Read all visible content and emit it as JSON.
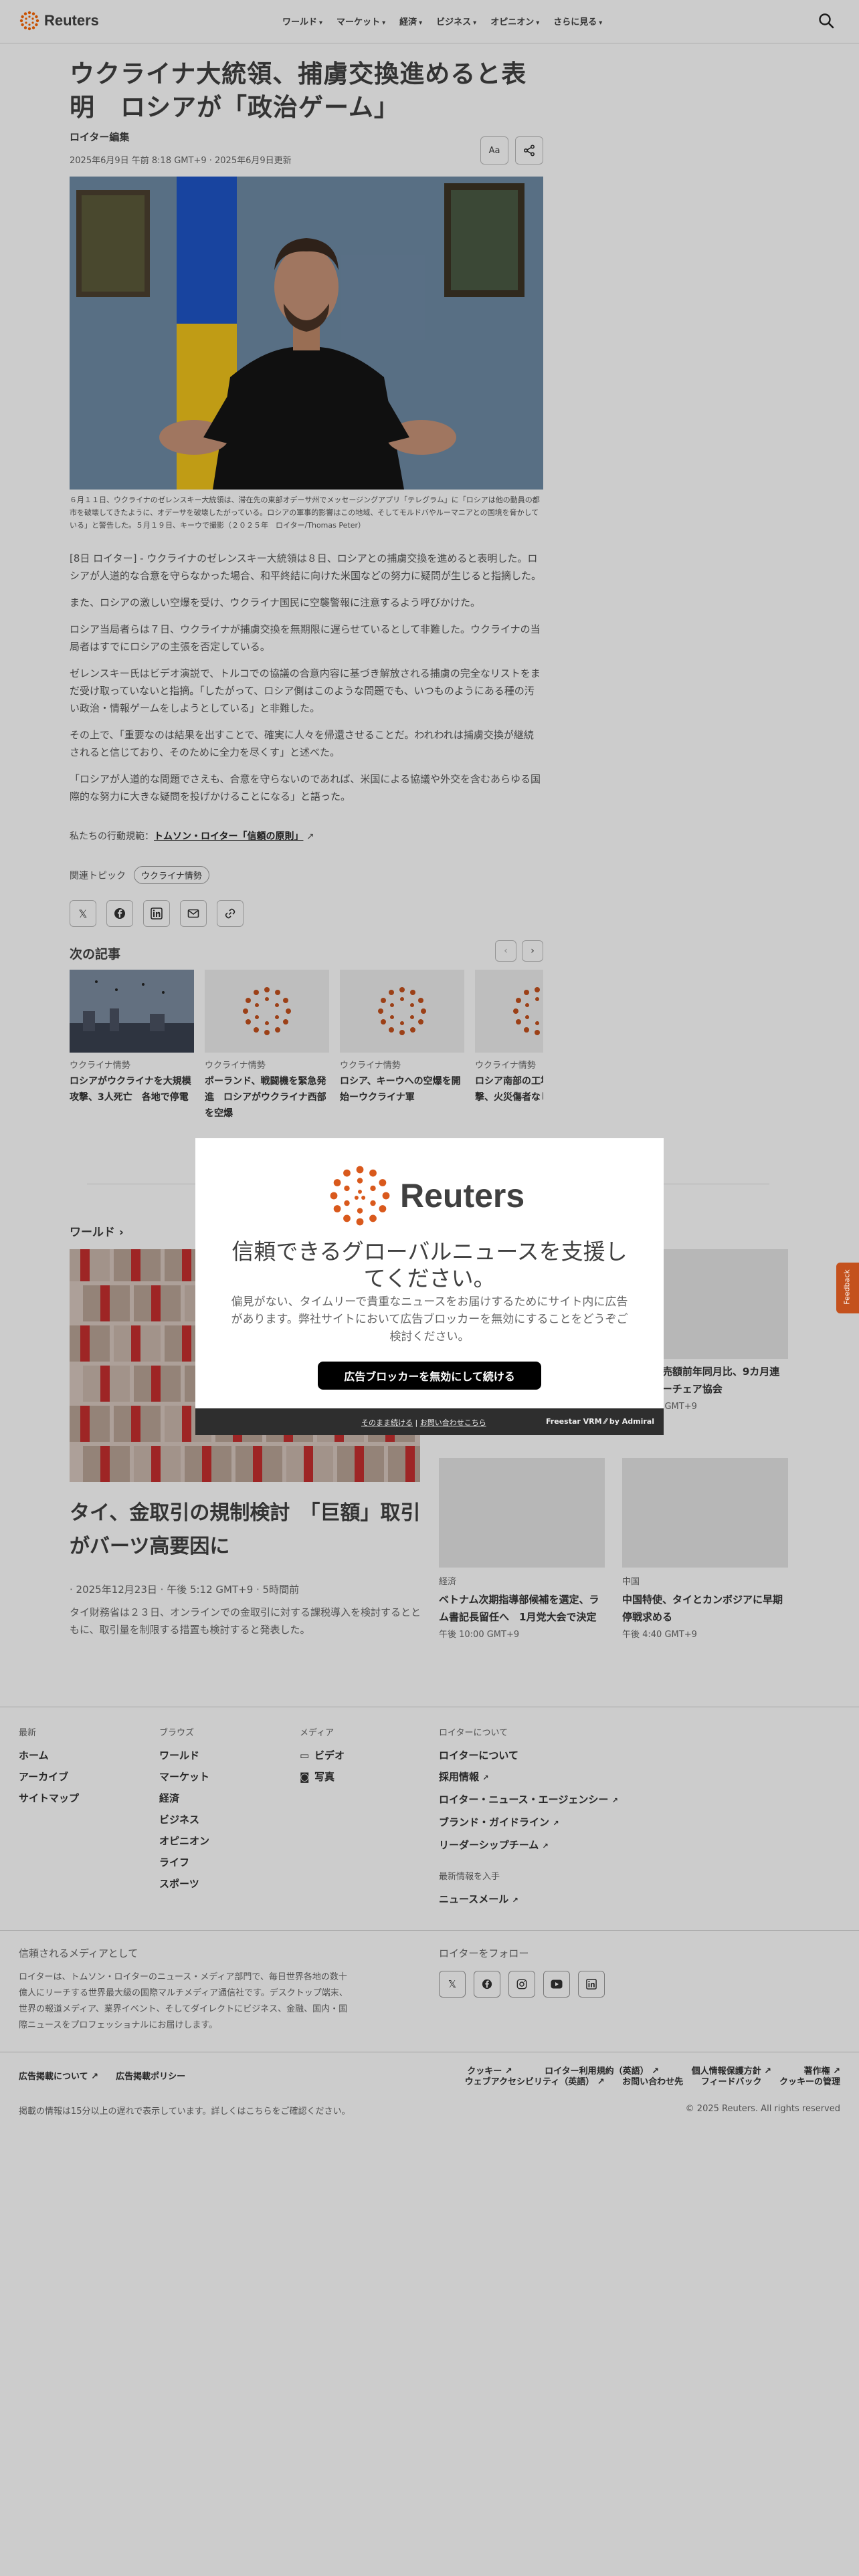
{
  "header": {
    "logo_text": "Reuters",
    "nav": [
      "ワールド",
      "マーケット",
      "経済",
      "ビジネス",
      "オピニオン",
      "さらに見る"
    ]
  },
  "article": {
    "title": "ウクライナ大統領、捕虜交換進めると表明　ロシアが「政治ゲーム」",
    "byline": "ロイター編集",
    "dateline": "2025年6月9日 午前 8:18 GMT+9 · 2025年6月9日更新",
    "font_tool": "Aa",
    "caption": "６月１１日、ウクライナのゼレンスキー大統領は、滞在先の東部オデーサ州でメッセージングアプリ「テレグラム」に「ロシアは他の動員の都市を破壊してきたように、オデーサを破壊したがっている。ロシアの軍事的影響はこの地域、そしてモルドバやルーマニアとの国境を脅かしている」と警告した。５月１９日、キーウで撮影（２０２５年　ロイター/Thomas Peter）",
    "paragraphs": [
      "[8日 ロイター] - ウクライナのゼレンスキー大統領は８日、ロシアとの捕虜交換を進めると表明した。ロシアが人道的な合意を守らなかった場合、和平終結に向けた米国などの努力に疑問が生じると指摘した。",
      "また、ロシアの激しい空爆を受け、ウクライナ国民に空襲警報に注意するよう呼びかけた。",
      "ロシア当局者らは７日、ウクライナが捕虜交換を無期限に遅らせているとして非難した。ウクライナの当局者はすでにロシアの主張を否定している。",
      "ゼレンスキー氏はビデオ演説で、トルコでの協議の合意内容に基づき解放される捕虜の完全なリストをまだ受け取っていないと指摘。「したがって、ロシア側はこのような問題でも、いつものようにある種の汚い政治・情報ゲームをしようとしている」と非難した。",
      "その上で、「重要なのは結果を出すことで、確実に人々を帰還させることだ。われわれは捕虜交換が継続されると信じており、そのために全力を尽くす」と述べた。",
      "「ロシアが人道的な問題でさえも、合意を守らないのであれば、米国による協議や外交を含むあらゆる国際的な努力に大きな疑問を投げかけることになる」と語った。"
    ],
    "principles_prefix": "私たちの行動規範：",
    "principles_link": "トムソン・ロイター「信頼の原則」",
    "topic_label": "関連トピック",
    "topic_chip": "ウクライナ情勢"
  },
  "next": {
    "heading": "次の記事",
    "cards": [
      {
        "kicker": "ウクライナ情勢",
        "title": "ロシアがウクライナを大規模攻撃、3人死亡　各地で停電"
      },
      {
        "kicker": "ウクライナ情勢",
        "title": "ポーランド、戦闘機を緊急発進　ロシアがウクライナ西部を空爆"
      },
      {
        "kicker": "ウクライナ情勢",
        "title": "ロシア、キーウへの空爆を開始ーウクライナ軍"
      },
      {
        "kicker": "ウクライナ情勢",
        "title": "ロシア南部の工場無人機攻撃、火災傷者なし＝当局"
      }
    ]
  },
  "world": {
    "heading": "ワールド",
    "lead_title": "タイ、金取引の規制検討　「巨額」取引がバーツ高要因に",
    "lead_date": "· 2025年12月23日 · 午後 5:12 GMT+9 · 5時間前",
    "lead_desc": "タイ財務省は２３日、オンラインでの金取引に対する課税導入を検討するとともに、取引量を制限する措置も検討すると発表した。",
    "items": [
      {
        "kicker": "",
        "title": "ーバー販売額前年同月比、9カ月連続プラスーチェア協会",
        "time": "午後 4:00 GMT+9"
      },
      {
        "kicker": "経済",
        "title": "ベトナム次期指導部候補を選定、ラム書記長留任へ　1月党大会で決定",
        "time": "午後 10:00 GMT+9"
      },
      {
        "kicker": "中国",
        "title": "中国特使、タイとカンボジアに早期停戦求める",
        "time": "午後 4:40 GMT+9"
      }
    ]
  },
  "footer": {
    "col1": {
      "head": "最新",
      "items": [
        "ホーム",
        "アーカイブ",
        "サイトマップ"
      ]
    },
    "col2": {
      "head": "ブラウズ",
      "items": [
        "ワールド",
        "マーケット",
        "経済",
        "ビジネス",
        "オピニオン",
        "ライフ",
        "スポーツ"
      ]
    },
    "col3": {
      "head": "メディア",
      "items": [
        "ビデオ",
        "写真"
      ]
    },
    "col4": {
      "head": "ロイターについて",
      "items": [
        "ロイターについて",
        "採用情報",
        "ロイター・ニュース・エージェンシー",
        "ブランド・ガイドライン",
        "リーダーシップチーム"
      ],
      "sub_head": "最新情報を入手",
      "sub_items": [
        "ニュースメール"
      ]
    },
    "trusted_head": "信頼されるメディアとして",
    "trusted_text": "ロイターは、トムソン・ロイターのニュース・メディア部門で、毎日世界各地の数十億人にリーチする世界最大級の国際マルチメディア通信社です。デスクトップ端末、世界の報道メディア、業界イベント、そしてダイレクトにビジネス、金融、国内・国際ニュースをプロフェッショナルにお届けします。",
    "follow_head": "ロイターをフォロー",
    "legal_left": [
      "広告掲載について",
      "広告掲載ポリシー"
    ],
    "legal_right_row1": [
      "クッキー",
      "ロイター利用規約（英語）",
      "個人情報保護方針",
      "著作権"
    ],
    "legal_right_row2": [
      "ウェブアクセシビリティ（英語）",
      "お問い合わせ先",
      "フィードバック",
      "クッキーの管理"
    ],
    "disclaimer": "掲載の情報は15分以上の遅れで表示しています。詳しくはこちらをご確認ください。",
    "copyright": "© 2025 Reuters. All rights reserved"
  },
  "modal": {
    "logo_text": "Reuters",
    "heading": "信頼できるグローバルニュースを支援してください。",
    "text": "偏見がない、タイムリーで貴重なニュースをお届けするためにサイト内に広告があります。弊社サイトにおいて広告ブロッカーを無効にすることをどうぞご検討ください。",
    "button": "広告ブロッカーを無効にして続ける",
    "continue_link": "そのまま続ける",
    "contact_link": "お問い合わせこちら",
    "brand": "Freestar VRM ⁄⁄ by Admiral"
  },
  "feedback": {
    "label": "Feedback"
  }
}
